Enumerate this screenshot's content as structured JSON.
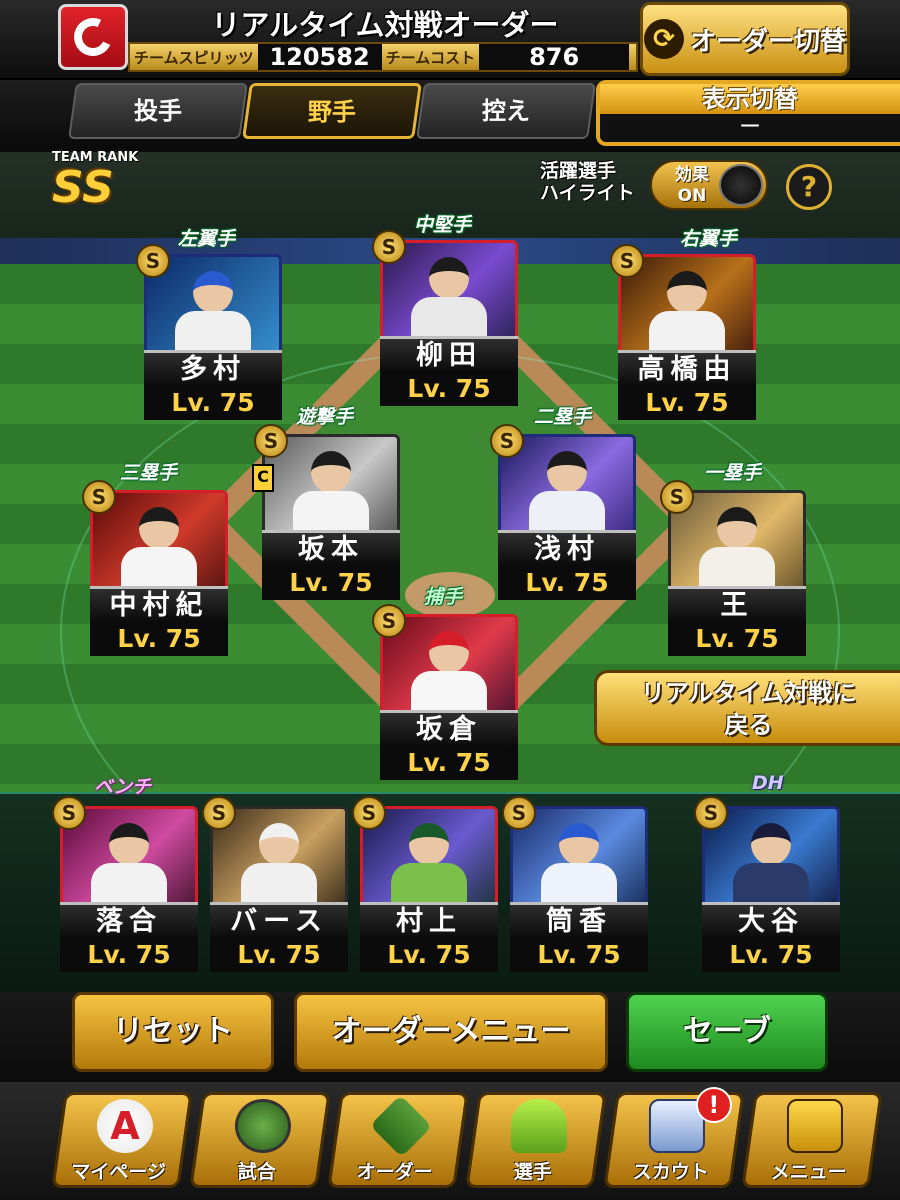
{
  "header": {
    "title": "リアルタイム対戦オーダー",
    "spirit_label": "チームスピリッツ",
    "spirit_value": "120582",
    "cost_label": "チームコスト",
    "cost_value": "876",
    "order_switch_label": "オーダー切替",
    "order_switch_icon": "swap-arrows-icon"
  },
  "tabs": [
    {
      "label": "投手",
      "active": false
    },
    {
      "label": "野手",
      "active": true
    },
    {
      "label": "控え",
      "active": false
    }
  ],
  "display_switch": {
    "label": "表示切替",
    "value": "ー"
  },
  "team_rank": {
    "label": "TEAM RANK",
    "value": "SS"
  },
  "highlight": {
    "label_line1": "活躍選手",
    "label_line2": "ハイライト",
    "toggle_line1": "効果",
    "toggle_line2": "ON"
  },
  "help_icon": "?",
  "positions": {
    "lf": "左翼手",
    "cf": "中堅手",
    "rf": "右翼手",
    "ss": "遊撃手",
    "b2": "二塁手",
    "b3": "三塁手",
    "b1": "一塁手",
    "c": "捕手",
    "bench": "ベンチ",
    "dh": "DH"
  },
  "players": {
    "lf": {
      "name": "多村",
      "level": "Lv. 75"
    },
    "cf": {
      "name": "柳田",
      "level": "Lv. 75"
    },
    "rf": {
      "name": "高橋由",
      "level": "Lv. 75"
    },
    "ss": {
      "name": "坂本",
      "level": "Lv. 75"
    },
    "b2": {
      "name": "浅村",
      "level": "Lv. 75"
    },
    "b3": {
      "name": "中村紀",
      "level": "Lv. 75"
    },
    "b1": {
      "name": "王",
      "level": "Lv. 75"
    },
    "c": {
      "name": "坂倉",
      "level": "Lv. 75"
    },
    "bench1": {
      "name": "落合",
      "level": "Lv. 75"
    },
    "bench2": {
      "name": "バース",
      "level": "Lv. 75"
    },
    "bench3": {
      "name": "村上",
      "level": "Lv. 75"
    },
    "bench4": {
      "name": "筒香",
      "level": "Lv. 75"
    },
    "dh": {
      "name": "大谷",
      "level": "Lv. 75"
    }
  },
  "rarity_mark": "S",
  "captain_mark": "C",
  "back_button": {
    "line1": "リアルタイム対戦に",
    "line2": "戻る"
  },
  "actions": {
    "reset": "リセット",
    "order_menu": "オーダーメニュー",
    "save": "セーブ"
  },
  "nav": [
    {
      "label": "マイページ",
      "icon": "a-badge-icon",
      "glyph": "A"
    },
    {
      "label": "試合",
      "icon": "stadium-icon",
      "glyph": ""
    },
    {
      "label": "オーダー",
      "icon": "field-order-icon",
      "glyph": ""
    },
    {
      "label": "選手",
      "icon": "player-icon",
      "glyph": ""
    },
    {
      "label": "スカウト",
      "icon": "scout-card-icon",
      "glyph": "",
      "badge": "!"
    },
    {
      "label": "メニュー",
      "icon": "menu-box-icon",
      "glyph": ""
    }
  ],
  "colors": {
    "accent_gold": "#e6b534",
    "team_red": "#d51e2a",
    "save_green": "#2fae2f"
  }
}
